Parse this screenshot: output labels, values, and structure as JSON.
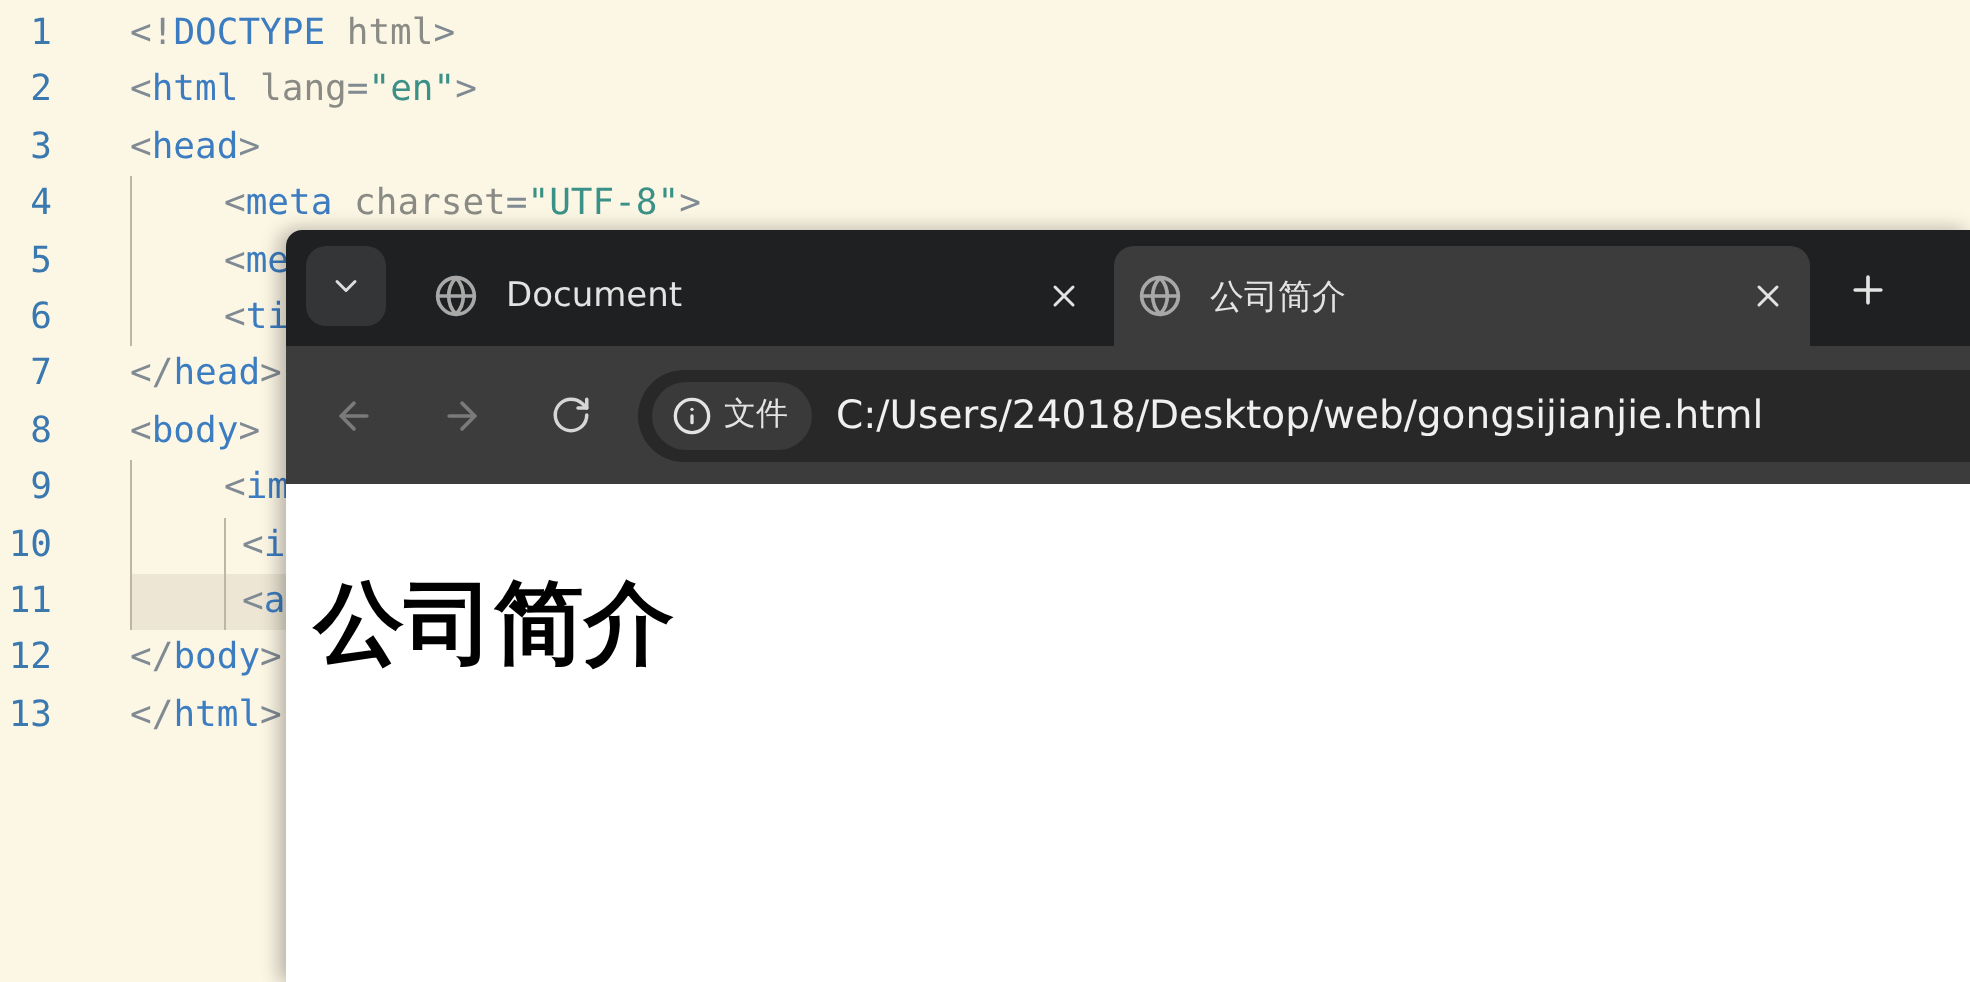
{
  "editor": {
    "lines": [
      {
        "number": "1",
        "highlighted": false,
        "tokens": [
          {
            "text": "<!",
            "kind": "punct"
          },
          {
            "text": "DOCTYPE",
            "kind": "tag"
          },
          {
            "text": " html",
            "kind": "attr"
          },
          {
            "text": ">",
            "kind": "punct"
          }
        ]
      },
      {
        "number": "2",
        "highlighted": false,
        "tokens": [
          {
            "text": "<",
            "kind": "punct"
          },
          {
            "text": "html",
            "kind": "tag"
          },
          {
            "text": " lang",
            "kind": "attr"
          },
          {
            "text": "=",
            "kind": "punct"
          },
          {
            "text": "\"en\"",
            "kind": "string"
          },
          {
            "text": ">",
            "kind": "punct"
          }
        ]
      },
      {
        "number": "3",
        "highlighted": false,
        "tokens": [
          {
            "text": "<",
            "kind": "punct"
          },
          {
            "text": "head",
            "kind": "tag"
          },
          {
            "text": ">",
            "kind": "punct"
          }
        ],
        "children": [
          {
            "number": "4",
            "highlighted": false,
            "tokens": [
              {
                "text": "<",
                "kind": "punct"
              },
              {
                "text": "meta",
                "kind": "tag"
              },
              {
                "text": " charset",
                "kind": "attr"
              },
              {
                "text": "=",
                "kind": "punct"
              },
              {
                "text": "\"UTF-8\"",
                "kind": "string"
              },
              {
                "text": ">",
                "kind": "punct"
              }
            ]
          },
          {
            "number": "5",
            "highlighted": false,
            "tokens": [
              {
                "text": "<",
                "kind": "punct"
              },
              {
                "text": "me",
                "kind": "tag"
              }
            ]
          },
          {
            "number": "6",
            "highlighted": false,
            "tokens": [
              {
                "text": "<",
                "kind": "punct"
              },
              {
                "text": "ti",
                "kind": "tag"
              }
            ]
          }
        ]
      },
      {
        "number": "7",
        "highlighted": false,
        "tokens": [
          {
            "text": "</",
            "kind": "punct"
          },
          {
            "text": "head",
            "kind": "tag"
          },
          {
            "text": ">",
            "kind": "punct"
          }
        ]
      },
      {
        "number": "8",
        "highlighted": false,
        "tokens": [
          {
            "text": "<",
            "kind": "punct"
          },
          {
            "text": "body",
            "kind": "tag"
          },
          {
            "text": ">",
            "kind": "punct"
          }
        ],
        "children": [
          {
            "number": "9",
            "highlighted": false,
            "tokens": [
              {
                "text": "<",
                "kind": "punct"
              },
              {
                "text": "im",
                "kind": "tag"
              }
            ],
            "children": [
              {
                "number": "10",
                "highlighted": false,
                "tokens": [
                  {
                    "text": "<",
                    "kind": "punct"
                  },
                  {
                    "text": "i",
                    "kind": "tag"
                  }
                ]
              },
              {
                "number": "11",
                "highlighted": true,
                "tokens": [
                  {
                    "text": "<",
                    "kind": "punct"
                  },
                  {
                    "text": "a",
                    "kind": "tag"
                  }
                ]
              }
            ]
          }
        ]
      },
      {
        "number": "12",
        "highlighted": false,
        "tokens": [
          {
            "text": "</",
            "kind": "punct"
          },
          {
            "text": "body",
            "kind": "tag"
          },
          {
            "text": ">",
            "kind": "punct"
          }
        ]
      },
      {
        "number": "13",
        "highlighted": false,
        "tokens": [
          {
            "text": "</",
            "kind": "punct"
          },
          {
            "text": "html",
            "kind": "tag"
          },
          {
            "text": ">",
            "kind": "punct"
          }
        ]
      }
    ]
  },
  "browser": {
    "tabs": [
      {
        "title": "Document",
        "selected": false
      },
      {
        "title": "公司简介",
        "selected": true
      }
    ],
    "nav_buttons": [
      {
        "kind": "back",
        "disabled": true
      },
      {
        "kind": "forward",
        "disabled": true
      },
      {
        "kind": "reload",
        "disabled": false
      }
    ],
    "address": {
      "chip": "文件",
      "url": "C:/Users/24018/Desktop/web/gongsijianjie.html"
    },
    "page": {
      "heading": "公司简介"
    }
  }
}
